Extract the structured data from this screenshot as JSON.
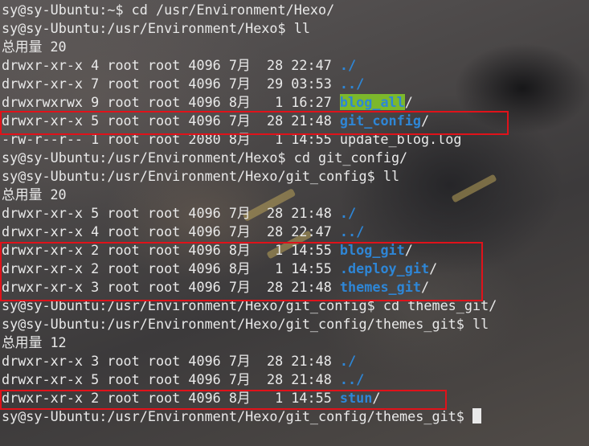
{
  "terminal": {
    "lines": [
      {
        "text": "sy@sy-Ubuntu:~$ cd /usr/Environment/Hexo/"
      },
      {
        "text": "sy@sy-Ubuntu:/usr/Environment/Hexo$ ll"
      },
      {
        "text": "总用量 20"
      },
      {
        "text": "drwxr-xr-x 4 root root 4096 7月  28 22:47 ",
        "name": "./",
        "slash": ""
      },
      {
        "text": "drwxr-xr-x 7 root root 4096 7月  29 03:53 ",
        "name": "../",
        "slash": ""
      },
      {
        "text": "drwxrwxrwx 9 root root 4096 8月   1 16:27 ",
        "name": "blog_all",
        "slash": "/",
        "highlight": true
      },
      {
        "text": "drwxr-xr-x 5 root root 4096 7月  28 21:48 ",
        "name": "git_config",
        "slash": "/"
      },
      {
        "text": "-rw-r--r-- 1 root root 2080 8月   1 14:55 update_blog.log"
      },
      {
        "text": "sy@sy-Ubuntu:/usr/Environment/Hexo$ cd git_config/"
      },
      {
        "text": "sy@sy-Ubuntu:/usr/Environment/Hexo/git_config$ ll"
      },
      {
        "text": "总用量 20"
      },
      {
        "text": "drwxr-xr-x 5 root root 4096 7月  28 21:48 ",
        "name": "./",
        "slash": ""
      },
      {
        "text": "drwxr-xr-x 4 root root 4096 7月  28 22:47 ",
        "name": "../",
        "slash": ""
      },
      {
        "text": "drwxr-xr-x 2 root root 4096 8月   1 14:55 ",
        "name": "blog_git",
        "slash": "/"
      },
      {
        "text": "drwxr-xr-x 2 root root 4096 8月   1 14:55 ",
        "name": ".deploy_git",
        "slash": "/"
      },
      {
        "text": "drwxr-xr-x 3 root root 4096 7月  28 21:48 ",
        "name": "themes_git",
        "slash": "/"
      },
      {
        "text": "sy@sy-Ubuntu:/usr/Environment/Hexo/git_config$ cd themes_git/"
      },
      {
        "text": "sy@sy-Ubuntu:/usr/Environment/Hexo/git_config/themes_git$ ll"
      },
      {
        "text": "总用量 12"
      },
      {
        "text": "drwxr-xr-x 3 root root 4096 7月  28 21:48 ",
        "name": "./",
        "slash": ""
      },
      {
        "text": "drwxr-xr-x 5 root root 4096 7月  28 21:48 ",
        "name": "../",
        "slash": ""
      },
      {
        "text": "drwxr-xr-x 2 root root 4096 8月   1 14:55 ",
        "name": "stun",
        "slash": "/"
      },
      {
        "text": "sy@sy-Ubuntu:/usr/Environment/Hexo/git_config/themes_git$ ",
        "cursor": true
      }
    ]
  },
  "colors": {
    "text": "#e9e9e9",
    "directory": "#2e86d6",
    "highlight_bg": "#7cb82c",
    "annotation_box": "#e0121a"
  }
}
